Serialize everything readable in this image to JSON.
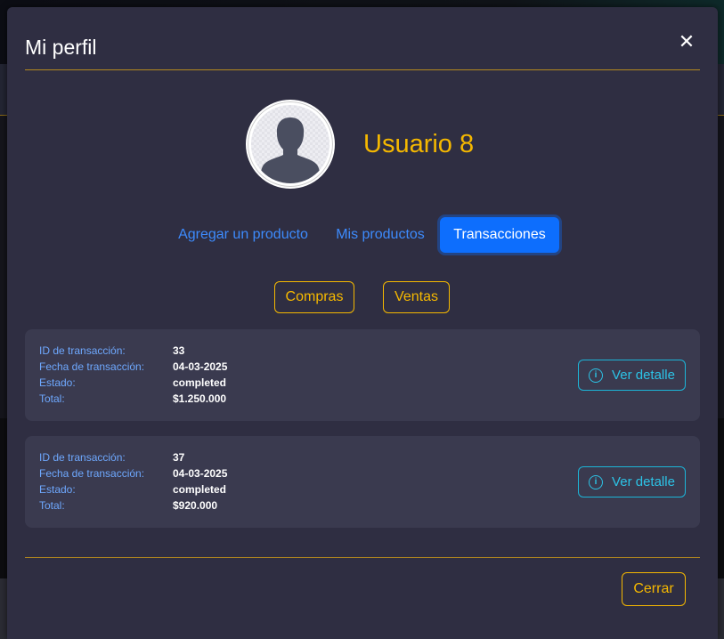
{
  "modal": {
    "title": "Mi perfil",
    "close_icon": "close-icon"
  },
  "profile": {
    "username": "Usuario 8",
    "avatar_icon": "user-silhouette-icon"
  },
  "tabs": [
    {
      "label": "Agregar un producto",
      "active": false
    },
    {
      "label": "Mis productos",
      "active": false
    },
    {
      "label": "Transacciones",
      "active": true
    }
  ],
  "subtabs": [
    {
      "label": "Compras"
    },
    {
      "label": "Ventas"
    }
  ],
  "transactions": {
    "labels": {
      "id": "ID de transacción:",
      "date": "Fecha de transacción:",
      "status": "Estado:",
      "total": "Total:"
    },
    "detail_label": "Ver detalle",
    "items": [
      {
        "id": "33",
        "date": "04-03-2025",
        "status": "completed",
        "total": "$1.250.000"
      },
      {
        "id": "37",
        "date": "04-03-2025",
        "status": "completed",
        "total": "$920.000"
      }
    ]
  },
  "footer": {
    "close_label": "Cerrar"
  },
  "colors": {
    "modal_bg": "#2f2e42",
    "accent_yellow": "#f5b800",
    "primary_blue": "#0d6efd",
    "link_blue": "#3d8bfd",
    "info_cyan": "#2cc3e6",
    "card_bg": "#3a3a4f"
  }
}
